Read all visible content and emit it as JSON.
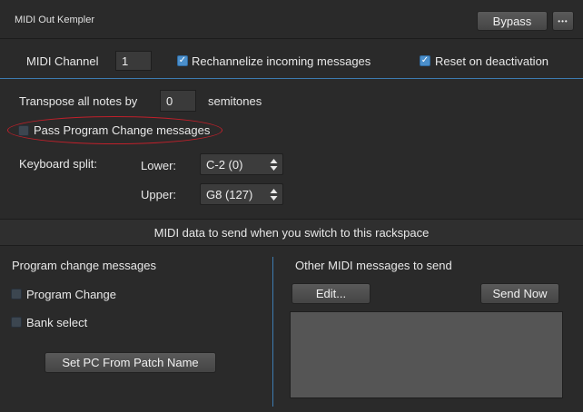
{
  "header": {
    "title": "MIDI Out Kempler",
    "bypass_label": "Bypass",
    "more_label": "•••"
  },
  "channel": {
    "label": "MIDI Channel",
    "value": "1",
    "rechannelize_label": "Rechannelize incoming messages",
    "rechannelize_checked": true,
    "reset_label": "Reset on deactivation",
    "reset_checked": true
  },
  "transpose": {
    "label": "Transpose all notes by",
    "value": "0",
    "unit": "semitones"
  },
  "pass_pc": {
    "label": "Pass Program Change messages",
    "checked": false,
    "annotation_color": "#c0202a"
  },
  "split": {
    "label": "Keyboard split:",
    "lower_label": "Lower:",
    "lower_value": "C-2 (0)",
    "upper_label": "Upper:",
    "upper_value": "G8 (127)"
  },
  "section": {
    "title": "MIDI data to send when you switch to this rackspace"
  },
  "pc_panel": {
    "title": "Program change messages",
    "program_change_label": "Program Change",
    "program_change_checked": false,
    "bank_select_label": "Bank select",
    "bank_select_checked": false,
    "set_pc_label": "Set PC From Patch Name"
  },
  "other_panel": {
    "title": "Other MIDI messages to send",
    "edit_label": "Edit...",
    "send_now_label": "Send Now",
    "messages_text": ""
  },
  "colors": {
    "accent": "#3d7bb0",
    "check_on": "#4b8fcb",
    "background": "#2a2a2a"
  }
}
